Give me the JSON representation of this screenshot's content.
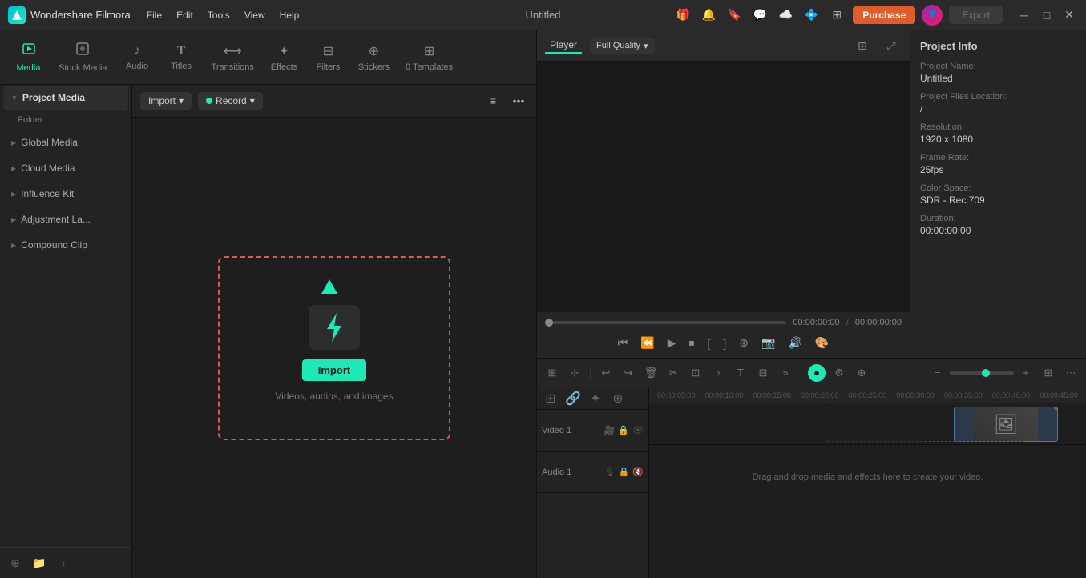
{
  "titlebar": {
    "app_name": "Wondershare Filmora",
    "title": "Untitled",
    "menu": [
      "File",
      "Edit",
      "Tools",
      "View",
      "Help"
    ],
    "purchase_label": "Purchase",
    "export_label": "Export",
    "minimize": "─",
    "maximize": "□",
    "close": "✕"
  },
  "tabs": [
    {
      "id": "media",
      "label": "Media",
      "icon": "🎬",
      "active": true
    },
    {
      "id": "stock_media",
      "label": "Stock Media",
      "icon": "📷"
    },
    {
      "id": "audio",
      "label": "Audio",
      "icon": "🎵"
    },
    {
      "id": "titles",
      "label": "Titles",
      "icon": "T"
    },
    {
      "id": "transitions",
      "label": "Transitions",
      "icon": "⟷"
    },
    {
      "id": "effects",
      "label": "Effects",
      "icon": "✨"
    },
    {
      "id": "filters",
      "label": "Filters",
      "icon": "🔲"
    },
    {
      "id": "stickers",
      "label": "Stickers",
      "icon": "🌟"
    },
    {
      "id": "templates",
      "label": "0 Templates",
      "icon": "▦"
    }
  ],
  "sidebar": {
    "items": [
      {
        "id": "project_media",
        "label": "Project Media",
        "active": true
      },
      {
        "id": "folder",
        "label": "Folder"
      },
      {
        "id": "global_media",
        "label": "Global Media"
      },
      {
        "id": "cloud_media",
        "label": "Cloud Media"
      },
      {
        "id": "influence_kit",
        "label": "Influence Kit"
      },
      {
        "id": "adjustment_la",
        "label": "Adjustment La..."
      },
      {
        "id": "compound_clip",
        "label": "Compound Clip"
      }
    ]
  },
  "media_toolbar": {
    "import_label": "Import",
    "record_label": "Record"
  },
  "dropzone": {
    "button_label": "Import",
    "description": "Videos, audios, and images"
  },
  "player": {
    "tab_player": "Player",
    "quality": "Full Quality",
    "time_current": "00:00:00:00",
    "time_total": "00:00:00:00",
    "progress": 0
  },
  "project_info": {
    "title": "Project Info",
    "name_label": "Project Name:",
    "name_value": "Untitled",
    "files_label": "Project Files Location:",
    "files_value": "/",
    "resolution_label": "Resolution:",
    "resolution_value": "1920 x 1080",
    "frame_rate_label": "Frame Rate:",
    "frame_rate_value": "25fps",
    "color_space_label": "Color Space:",
    "color_space_value": "SDR - Rec.709",
    "duration_label": "Duration:",
    "duration_value": "00:00:00:00"
  },
  "timeline": {
    "ruler_marks": [
      "00:00:05:00",
      "00:00:10:00",
      "00:00:15:00",
      "00:00:20:00",
      "00:00:25:00",
      "00:00:30:00",
      "00:00:35:00",
      "00:00:40:00",
      "00:00:45:00"
    ],
    "drop_text": "Drag and drop media and effects here to create your video.",
    "tracks": [
      {
        "id": "video1",
        "label": "Video 1"
      },
      {
        "id": "audio1",
        "label": "Audio 1"
      }
    ]
  }
}
